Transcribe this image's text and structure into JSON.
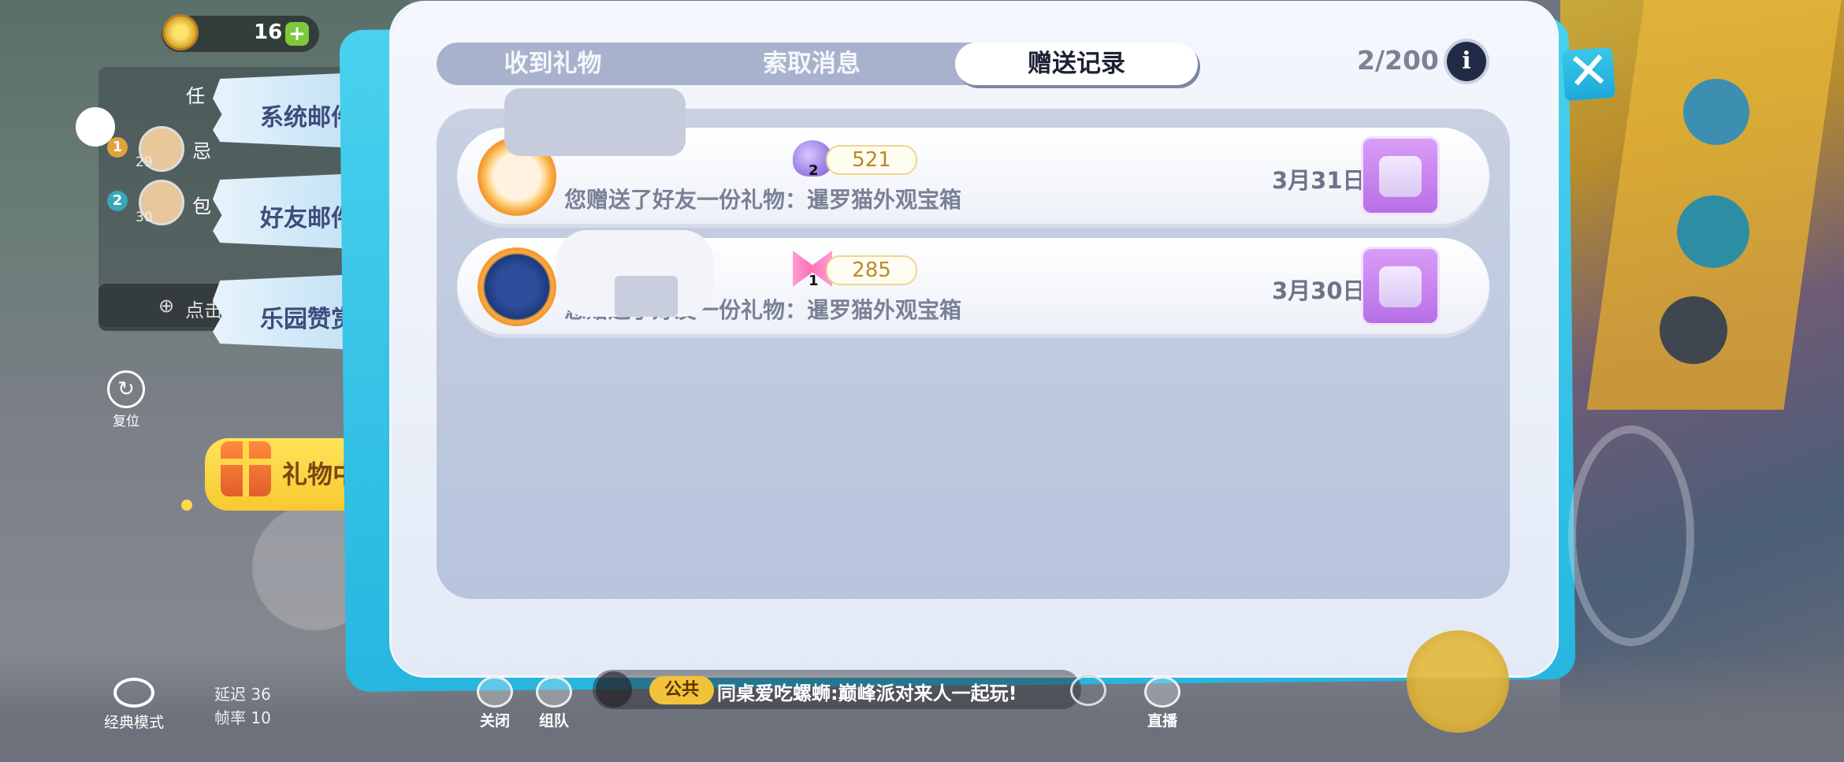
{
  "hud": {
    "coin_count": "16",
    "coin_plus": "+",
    "task_label": "任",
    "rows": [
      {
        "rank": "1",
        "level": "29",
        "name": "忌"
      },
      {
        "rank": "2",
        "level": "30",
        "name": "包"
      }
    ],
    "click_btn": "点击",
    "reset_label": "复位",
    "reset_icon": "↻",
    "mode_label": "经典模式",
    "latency_label": "延迟 36",
    "fps_label": "帧率 10"
  },
  "side_tabs": {
    "system_mail": "系统邮件",
    "friend_mail": "好友邮件",
    "park_reward": "乐园赞赏",
    "gift_center": "礼物中心"
  },
  "tabs": [
    {
      "label": "收到礼物",
      "active": false
    },
    {
      "label": "索取消息",
      "active": false
    },
    {
      "label": "赠送记录",
      "active": true
    }
  ],
  "counter": "2/200",
  "info_icon": "i",
  "close_icon": "✕",
  "records": [
    {
      "text": "您赠送了好友一份礼物：暹罗猫外观宝箱",
      "item_qty": "2",
      "score": "521",
      "date": "3月31日",
      "item_icon": "bubble-icon"
    },
    {
      "text": "您赠送了好友一份礼物：暹罗猫外观宝箱",
      "item_qty": "1",
      "score": "285",
      "date": "3月30日",
      "item_icon": "bow-icon"
    }
  ],
  "chat": {
    "tag": "公共",
    "message": "同桌爱吃螺蛳:巅峰派对来人一起玩!"
  },
  "bottom_buttons": {
    "close": "关闭",
    "team": "组队",
    "live": "直播"
  },
  "colors": {
    "accent_cyan": "#27b6e0",
    "tab_active_bg": "#ffffff",
    "score_color": "#b88a25",
    "gift_tab": "#f7c930"
  }
}
